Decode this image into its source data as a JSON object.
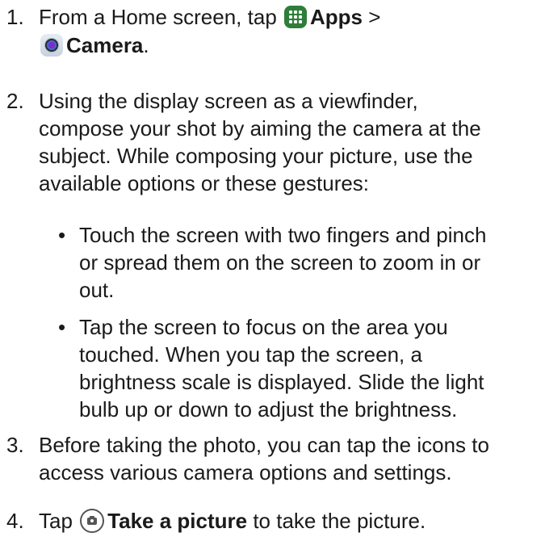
{
  "steps": [
    {
      "number": "1.",
      "prefix": "From a Home screen, tap",
      "apps_label": "Apps",
      "separator": ">",
      "camera_label": "Camera",
      "suffix": "."
    },
    {
      "number": "2.",
      "lines": [
        "Using the display screen as a viewfinder,",
        "compose your shot by aiming the camera at the",
        "subject. While composing your picture, use the",
        "available options or these gestures:"
      ],
      "bullets": [
        {
          "lines": [
            "Touch the screen with two fingers and pinch",
            "or spread them on the screen to zoom in or",
            "out."
          ]
        },
        {
          "lines": [
            "Tap the screen to focus on the area you",
            "touched. When you tap the screen, a",
            "brightness scale is displayed. Slide the light",
            "bulb up or down to adjust the brightness."
          ]
        }
      ]
    },
    {
      "number": "3.",
      "lines": [
        "Before taking the photo, you can tap the icons to",
        "access various camera options and settings."
      ]
    },
    {
      "number": "4.",
      "prefix": "Tap",
      "button_label": "Take a picture",
      "suffix": "to take the picture."
    }
  ],
  "icons": {
    "apps": "apps-grid-icon",
    "camera": "camera-app-icon",
    "shutter": "shutter-button-icon"
  },
  "colors": {
    "text": "#1a1a1a",
    "apps_icon_bg": "#2e7d3a"
  }
}
